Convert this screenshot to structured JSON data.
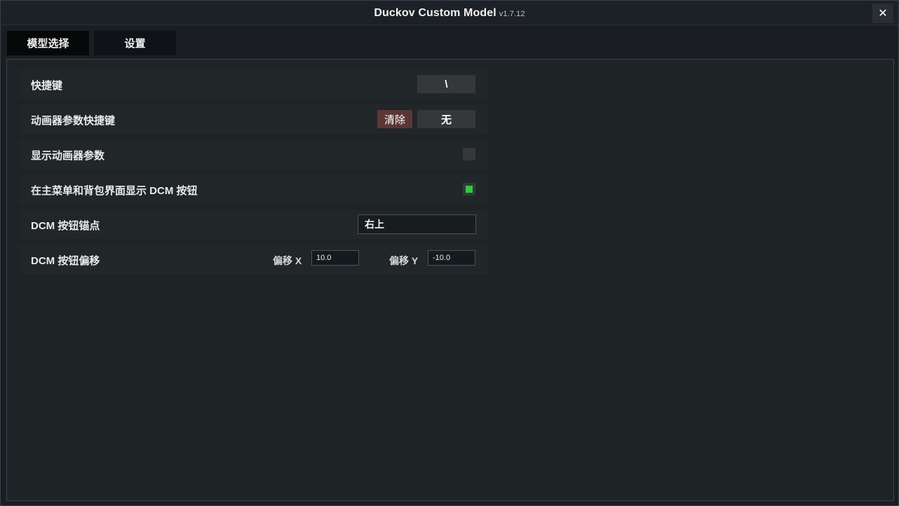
{
  "window": {
    "title": "Duckov Custom Model",
    "version": "v1.7.12",
    "close_symbol": "✕"
  },
  "tabs": [
    {
      "label": "模型选择",
      "active": true
    },
    {
      "label": "设置",
      "active": false
    }
  ],
  "settings": {
    "hotkey": {
      "label": "快捷键",
      "value": "\\"
    },
    "animator_hotkey": {
      "label": "动画器参数快捷键",
      "clear_label": "清除",
      "value": "无"
    },
    "show_animator_params": {
      "label": "显示动画器参数",
      "checked": false
    },
    "show_dcm_button": {
      "label": "在主菜单和背包界面显示 DCM 按钮",
      "checked": true
    },
    "dcm_anchor": {
      "label": "DCM 按钮锚点",
      "value": "右上"
    },
    "dcm_offset": {
      "label": "DCM 按钮偏移",
      "x_label": "偏移 X",
      "x_value": "10.0",
      "y_label": "偏移 Y",
      "y_value": "-10.0"
    }
  },
  "colors": {
    "checkbox_on": "#33c83d",
    "clear_button": "#5a3737",
    "panel_bg": "#1e2326"
  }
}
